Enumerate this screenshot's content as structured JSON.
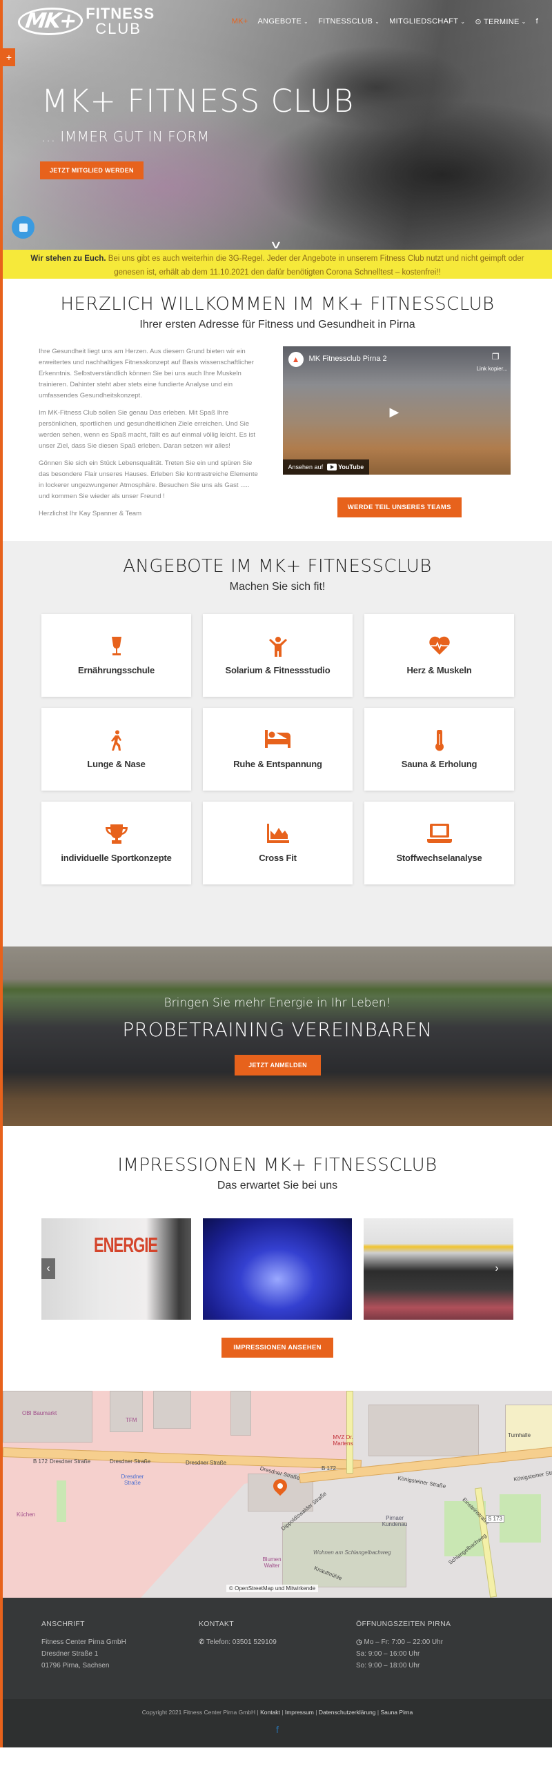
{
  "header": {
    "logo_mark": "MK+",
    "logo_line1": "FITNESS",
    "logo_line2": "CLUB",
    "nav": [
      {
        "label": "MK+",
        "active": true,
        "dropdown": false
      },
      {
        "label": "ANGEBOTE",
        "dropdown": true
      },
      {
        "label": "FITNESSCLUB",
        "dropdown": true
      },
      {
        "label": "MITGLIEDSCHAFT",
        "dropdown": true
      },
      {
        "label": "⊙ TERMINE",
        "dropdown": true
      }
    ],
    "facebook_icon": "f"
  },
  "hero": {
    "side_tab": "+",
    "title": "MK+ FITNESS CLUB",
    "subtitle": "... IMMER GUT IN FORM",
    "cta": "JETZT MITGLIED WERDEN",
    "scroll_icon": "∨"
  },
  "notice": {
    "bold": "Wir stehen zu Euch.",
    "text": " Bei uns gibt es auch weiterhin die 3G-Regel. Jeder der Angebote in unserem Fitness Club nutzt und nicht geimpft oder genesen ist, erhält ab dem 11.10.2021 den dafür benötigten Corona Schnelltest – kostenfrei!!"
  },
  "welcome": {
    "title": "HERZLICH WILLKOMMEN IM MK+ FITNESSCLUB",
    "subtitle": "Ihrer ersten Adresse für Fitness und Gesundheit in Pirna",
    "paragraphs": [
      "Ihre Gesundheit liegt uns am Herzen. Aus diesem Grund bieten wir ein erweitertes und nachhaltiges Fitnesskonzept auf Basis wissenschaftlicher Erkenntnis. Selbstverständlich können Sie bei uns auch Ihre Muskeln trainieren. Dahinter steht aber stets eine fundierte Analyse und ein umfassendes Gesundheitskonzept.",
      "Im MK-Fitness Club sollen Sie genau Das erleben. Mit Spaß Ihre persönlichen, sportlichen und gesundheitlichen Ziele erreichen. Und Sie werden sehen, wenn es Spaß macht, fällt es auf einmal völlig leicht. Es ist unser Ziel, dass Sie diesen Spaß erleben. Daran setzen wir alles!",
      "Gönnen Sie sich ein Stück Lebensqualität. Treten Sie ein und spüren Sie das besondere Flair unseres Hauses. Erleben Sie kontrastreiche Elemente in lockerer ungezwungener Atmosphäre. Besuchen Sie uns als Gast ..... und kommen Sie wieder als unser Freund !",
      "Herzlichst Ihr Kay Spanner & Team"
    ],
    "video": {
      "title": "MK Fitnessclub Pirna 2",
      "copy_label": "Link kopier...",
      "watch_on": "Ansehen auf",
      "youtube": "YouTube"
    },
    "team_button": "WERDE TEIL UNSERES TEAMS"
  },
  "offers": {
    "title": "ANGEBOTE IM MK+ FITNESSCLUB",
    "subtitle": "Machen Sie sich fit!",
    "items": [
      {
        "label": "Ernährungsschule",
        "icon": "glass-icon",
        "glyph": "🍷"
      },
      {
        "label": "Solarium & Fitnessstudio",
        "icon": "child-icon",
        "glyph": "🙌"
      },
      {
        "label": "Herz & Muskeln",
        "icon": "heartbeat-icon",
        "glyph": "♥"
      },
      {
        "label": "Lunge & Nase",
        "icon": "walking-icon",
        "glyph": "🚶"
      },
      {
        "label": "Ruhe & Entspannung",
        "icon": "bed-icon",
        "glyph": "🛏"
      },
      {
        "label": "Sauna & Erholung",
        "icon": "thermometer-icon",
        "glyph": "🌡"
      },
      {
        "label": "individuelle Sportkonzepte",
        "icon": "trophy-icon",
        "glyph": "🏆"
      },
      {
        "label": "Cross Fit",
        "icon": "area-chart-icon",
        "glyph": "📈"
      },
      {
        "label": "Stoffwechselanalyse",
        "icon": "laptop-icon",
        "glyph": "💻"
      }
    ]
  },
  "probe": {
    "line1": "Bringen Sie mehr Energie in Ihr Leben!",
    "line2": "PROBETRAINING VEREINBAREN",
    "button": "JETZT ANMELDEN"
  },
  "impressions": {
    "title": "IMPRESSIONEN MK+ FITNESSCLUB",
    "subtitle": "Das erwartet Sie bei uns",
    "photo1_text": "ENERGIE",
    "prev": "‹",
    "next": "›",
    "button": "IMPRESSIONEN ANSEHEN"
  },
  "map": {
    "labels": {
      "b172_a": "B 172",
      "dresdner1": "Dresdner Straße",
      "dresdner2": "Dresdner Straße",
      "dresdner3": "Dresdner Straße",
      "dresdner4": "Dresdner Straße",
      "b172_b": "B 172",
      "koenigsteiner1": "Königsteiner Straße",
      "koenigsteiner2": "Königsteiner Straße",
      "dippoldiswalder": "Dippoldiswalder Straße",
      "einsteinstr": "Einsteinstraße",
      "s173": "S 173",
      "schlangelbachweg": "Schlangelbachweg",
      "wohnen": "Wohnen am Schlangelbachweg",
      "knaufmuehle": "Knaufmühle",
      "obi": "OBI Baumarkt",
      "tfm": "TFM",
      "turnhalle": "Turnhalle",
      "mvz": "MVZ Dr. Martens",
      "blumen": "Blumen Walter",
      "kuechen": "Küchen",
      "pirnaer": "Pirnaer Kundenau",
      "dresdner_stop": "Dresdner Straße"
    },
    "attribution": "© OpenStreetMap und Mitwirkende"
  },
  "footer": {
    "address": {
      "heading": "ANSCHRIFT",
      "lines": [
        "Fitness Center Pirna GmbH",
        "Dresdner Straße 1",
        "01796 Pirna, Sachsen"
      ]
    },
    "contact": {
      "heading": "KONTAKT",
      "phone": "Telefon: 03501 529109"
    },
    "hours": {
      "heading": "ÖFFNUNGSZEITEN PIRNA",
      "lines": [
        "Mo – Fr: 7:00 – 22:00 Uhr",
        "Sa: 9:00 – 16:00 Uhr",
        "So: 9:00 – 18:00 Uhr"
      ]
    },
    "copyright": "Copyright 2021 Fitness Center Pirna GmbH",
    "links": [
      "Kontakt",
      "Impressum",
      "Datenschutzerklärung",
      "Sauna Pirna"
    ],
    "separator": " | ",
    "facebook": "f"
  },
  "colors": {
    "accent": "#e7621c",
    "notice_bg": "#f6e93a",
    "footer_bg": "#363839",
    "bottom_bg": "#2e3030"
  }
}
